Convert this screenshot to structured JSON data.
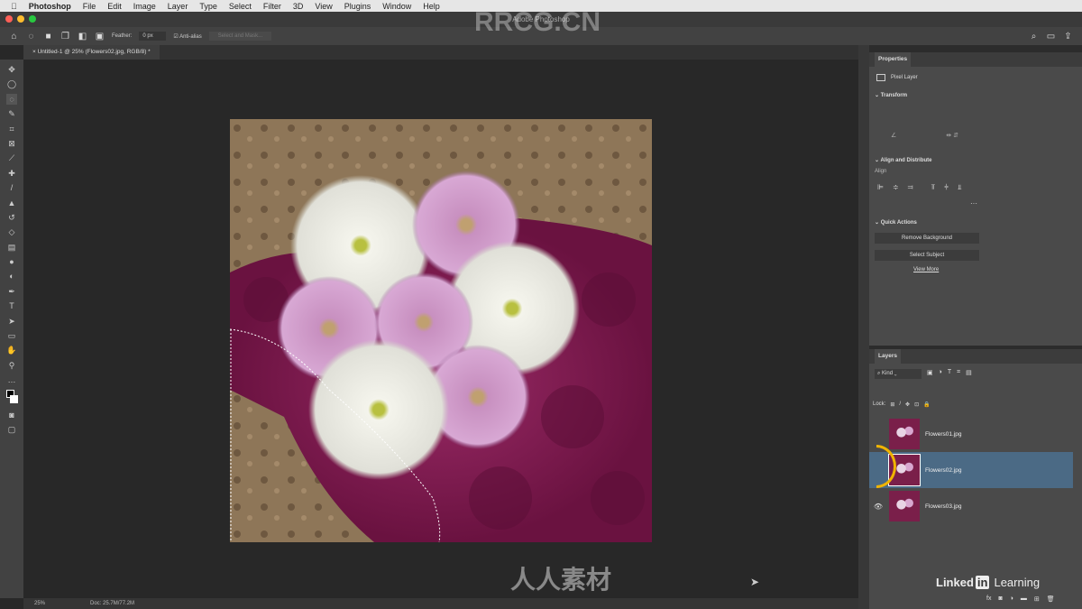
{
  "menubar": {
    "apple": "",
    "app": "Photoshop",
    "items": [
      "File",
      "Edit",
      "Image",
      "Layer",
      "Type",
      "Select",
      "Filter",
      "3D",
      "View",
      "Plugins",
      "Window",
      "Help"
    ]
  },
  "window": {
    "title": "Adobe Photoshop"
  },
  "options": {
    "feather_label": "Feather:",
    "feather_value": "0 px",
    "antialias": "Anti-alias",
    "select_mask": "Select and Mask..."
  },
  "document": {
    "tab": "Untitled-1 @ 25% (Flowers02.jpg, RGB/8) *"
  },
  "status": {
    "zoom": "25%",
    "doc": "Doc: 25.7M/77.2M"
  },
  "properties": {
    "title": "Properties",
    "layer_type": "Pixel Layer",
    "transform": "Transform",
    "align_distribute": "Align and Distribute",
    "align": "Align",
    "quick_actions": "Quick Actions",
    "remove_bg": "Remove Background",
    "select_subject": "Select Subject",
    "view_more": "View More"
  },
  "layers": {
    "title": "Layers",
    "filter": "Kind",
    "lock": "Lock:",
    "items": [
      {
        "name": "Flowers01.jpg",
        "visible": false,
        "selected": false
      },
      {
        "name": "Flowers02.jpg",
        "visible": false,
        "selected": true
      },
      {
        "name": "Flowers03.jpg",
        "visible": true,
        "selected": false
      }
    ]
  },
  "branding": {
    "linkedin": "Linked",
    "in": "in",
    "learning": "Learning",
    "watermark": "RRCG.CN",
    "watermark2": "人人素材"
  },
  "colors": {
    "selected_layer": "#4b6a85",
    "highlight_circle": "#f0b400"
  }
}
